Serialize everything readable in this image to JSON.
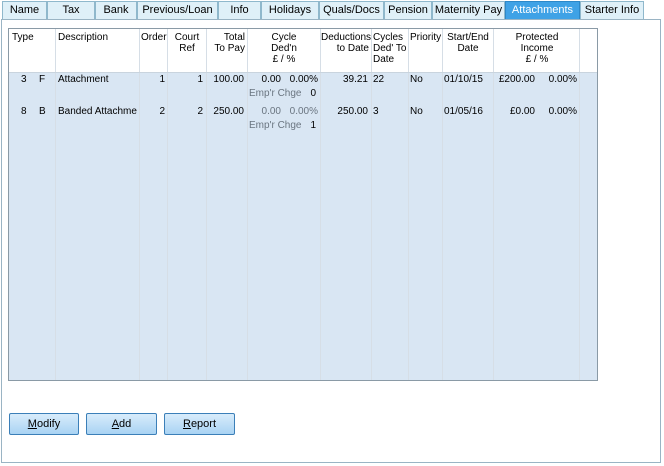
{
  "tabs": [
    {
      "label": "Name"
    },
    {
      "label": "Tax"
    },
    {
      "label": "Bank"
    },
    {
      "label": "Previous/Loan"
    },
    {
      "label": "Info"
    },
    {
      "label": "Holidays"
    },
    {
      "label": "Quals/Docs"
    },
    {
      "label": "Pension"
    },
    {
      "label": "Maternity Pay"
    },
    {
      "label": "Attachments"
    },
    {
      "label": "Starter Info"
    }
  ],
  "active_tab": "Attachments",
  "grid": {
    "headers": {
      "type": "Type",
      "description": "Description",
      "order": "Order",
      "court_ref_1": "Court",
      "court_ref_2": "Ref",
      "total_1": "Total",
      "total_2": "To Pay",
      "cycle_1": "Cycle",
      "cycle_2": "Ded'n",
      "cycle_3": "£ / %",
      "ded_1": "Deductions",
      "ded_2": "to Date",
      "cyc_1": "Cycles",
      "cyc_2": "Ded' To",
      "cyc_3": "Date",
      "priority": "Priority",
      "se_1": "Start/End",
      "se_2": "Date",
      "prot_1": "Protected",
      "prot_2": "Income",
      "prot_3": "£ / %"
    },
    "rows": [
      {
        "num": "3",
        "type": "F",
        "description": "Attachment",
        "order": "1",
        "court_ref": "1",
        "total": "100.00",
        "cycle_amount": "0.00",
        "cycle_pct": "0.00%",
        "empr_label": "Emp'r Chge",
        "empr_value": "0",
        "deductions": "39.21",
        "cycles": "22",
        "priority": "No",
        "start_end": "01/10/15",
        "protected_amount": "£200.00",
        "protected_pct": "0.00%"
      },
      {
        "num": "8",
        "type": "B",
        "description": "Banded Attachme",
        "order": "2",
        "court_ref": "2",
        "total": "250.00",
        "cycle_amount": "0.00",
        "cycle_pct": "0.00%",
        "empr_label": "Emp'r Chge",
        "empr_value": "1",
        "deductions": "250.00",
        "cycles": "3",
        "priority": "No",
        "start_end": "01/05/16",
        "protected_amount": "£0.00",
        "protected_pct": "0.00%"
      }
    ]
  },
  "buttons": {
    "modify_u": "M",
    "modify_rest": "odify",
    "add_u": "A",
    "add_rest": "dd",
    "report_u": "R",
    "report_rest": "eport"
  },
  "colors": {
    "active_tab": "#3fa2e6",
    "grid_bg": "#d9e6f3"
  }
}
